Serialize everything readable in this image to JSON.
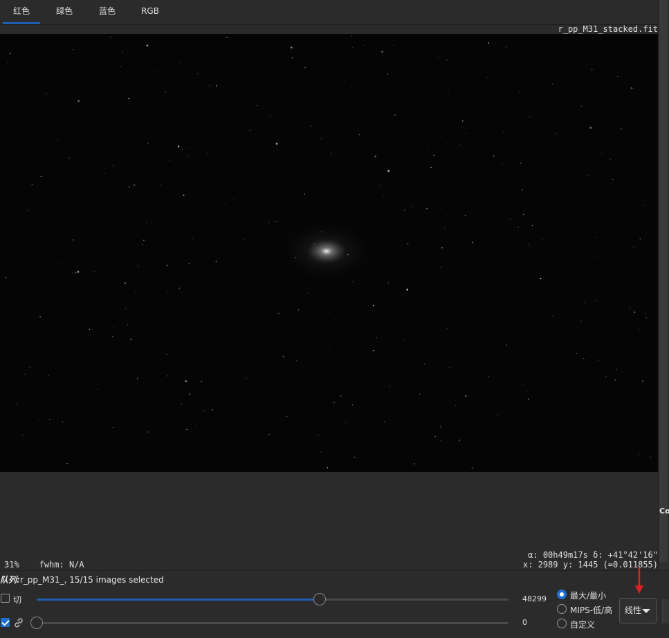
{
  "tabs": [
    {
      "label": "红色",
      "active": true
    },
    {
      "label": "绿色",
      "active": false
    },
    {
      "label": "蓝色",
      "active": false
    },
    {
      "label": "RGB",
      "active": false
    }
  ],
  "image": {
    "filename": "r_pp_M31_stacked.fit"
  },
  "status": {
    "zoom": "31%",
    "fwhm": "fwhm: N/A",
    "coord_line1": "α: 00h49m17s δ: +41°42'16\"",
    "coord_line2": "x: 2989 y: 1445 (=0.011855)"
  },
  "sequence": {
    "prefix": "队列:",
    "text": "r_pp_M31_, 15/15 images selected"
  },
  "controls": {
    "cut_label": "切",
    "cut_checked": false,
    "link_checked": true,
    "high_slider": {
      "value": "48299",
      "fraction": 0.6
    },
    "low_slider": {
      "value": "0",
      "fraction": 0.0
    },
    "radio_options": [
      {
        "label": "最大/最小",
        "checked": true
      },
      {
        "label": "MIPS-低/高",
        "checked": false
      },
      {
        "label": "自定义",
        "checked": false
      }
    ],
    "scale_dropdown": "线性"
  },
  "side_panel": {
    "label": "Co"
  },
  "colors": {
    "accent": "#1e5fb3",
    "annotation_arrow": "#e02020"
  }
}
